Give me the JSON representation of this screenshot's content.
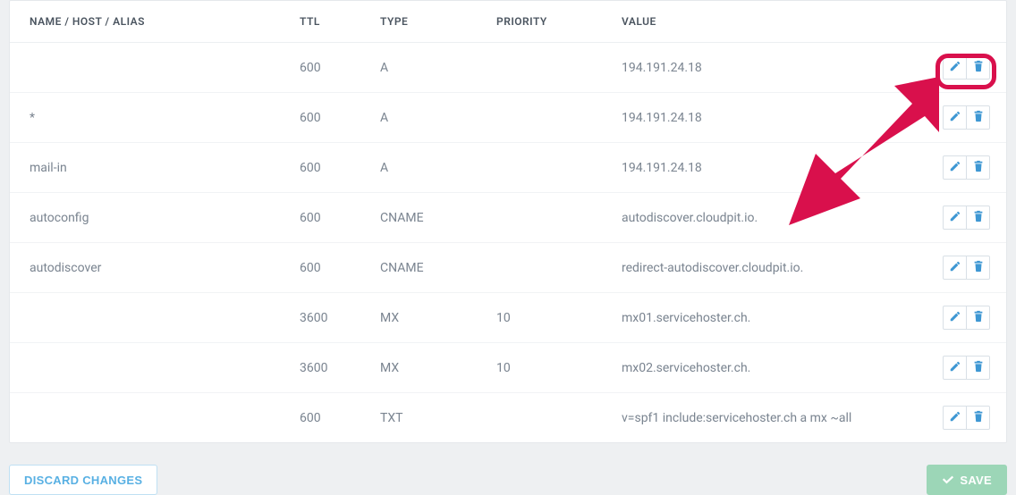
{
  "table": {
    "headers": {
      "name": "NAME / HOST / ALIAS",
      "ttl": "TTL",
      "type": "TYPE",
      "priority": "PRIORITY",
      "value": "VALUE"
    },
    "rows": [
      {
        "name": "",
        "ttl": "600",
        "type": "A",
        "priority": "",
        "value": "194.191.24.18"
      },
      {
        "name": "*",
        "ttl": "600",
        "type": "A",
        "priority": "",
        "value": "194.191.24.18"
      },
      {
        "name": "mail-in",
        "ttl": "600",
        "type": "A",
        "priority": "",
        "value": "194.191.24.18"
      },
      {
        "name": "autoconfig",
        "ttl": "600",
        "type": "CNAME",
        "priority": "",
        "value": "autodiscover.cloudpit.io."
      },
      {
        "name": "autodiscover",
        "ttl": "600",
        "type": "CNAME",
        "priority": "",
        "value": "redirect-autodiscover.cloudpit.io."
      },
      {
        "name": "",
        "ttl": "3600",
        "type": "MX",
        "priority": "10",
        "value": "mx01.servicehoster.ch."
      },
      {
        "name": "",
        "ttl": "3600",
        "type": "MX",
        "priority": "10",
        "value": "mx02.servicehoster.ch."
      },
      {
        "name": "",
        "ttl": "600",
        "type": "TXT",
        "priority": "",
        "value": "v=spf1 include:servicehoster.ch a mx ~all"
      }
    ]
  },
  "buttons": {
    "discard": "DISCARD CHANGES",
    "save": "SAVE"
  },
  "colors": {
    "accent_blue": "#3e97d3",
    "save_green": "#9cd6b7",
    "highlight_red": "#d9104c"
  },
  "annotation": {
    "highlight_row_index": 0,
    "target": "row-actions"
  }
}
